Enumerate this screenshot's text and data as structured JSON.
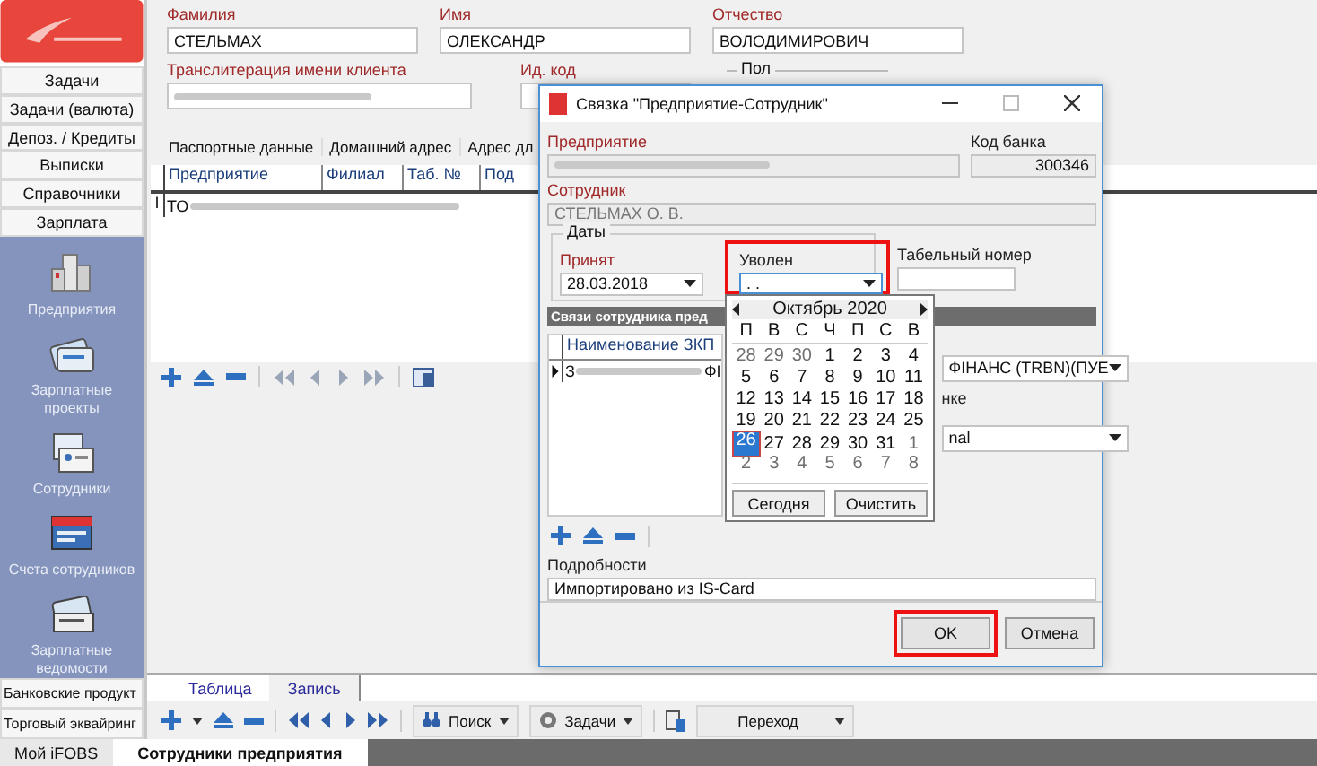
{
  "sidebar": {
    "nav_items": [
      "Задачи",
      "Задачи (валюта)",
      "Депоз. / Кредиты",
      "Выписки",
      "Справочники",
      "Зарплата"
    ],
    "panel_items": [
      {
        "label": "Предприятия",
        "kind": "building"
      },
      {
        "label": "Зарплатные проекты",
        "kind": "cards"
      },
      {
        "label": "Сотрудники",
        "kind": "badge"
      },
      {
        "label": "Счета сотрудников",
        "kind": "accounts"
      },
      {
        "label": "Зарплатные ведомости",
        "kind": "sheet"
      }
    ],
    "bottom_items": [
      "Банковские продукт",
      "Торговый эквайринг"
    ]
  },
  "client_form": {
    "fields": [
      {
        "label": "Фамилия",
        "value": "СТЕЛЬМАХ"
      },
      {
        "label": "Имя",
        "value": "ОЛЕКСАНДР"
      },
      {
        "label": "Отчество",
        "value": "ВОЛОДИМИРОВИЧ"
      }
    ],
    "translit_label": "Транслитерация имени клиента",
    "translit_redacted": true,
    "id_label": "Ид. код",
    "gender_legend": "Пол"
  },
  "detail_tabs": [
    {
      "label": "Паспортные данные",
      "selected": false
    },
    {
      "label": "Домашний адрес",
      "selected": false
    },
    {
      "label": "Адрес дл",
      "selected": false
    }
  ],
  "table": {
    "columns": [
      "Предприятие",
      "Филиал",
      "Таб. №",
      "Под"
    ],
    "row_marker": "I",
    "rows": [
      {
        "cells": [
          "ТО"
        ],
        "redacted": true
      }
    ]
  },
  "view_tabs": [
    {
      "label": "Таблица",
      "selected": true
    },
    {
      "label": "Запись",
      "selected": false
    }
  ],
  "bottom_toolbar": {
    "buttons": [
      "Поиск",
      "Задачи",
      "Переход"
    ]
  },
  "footer_tabs": [
    {
      "label": "Мой iFOBS",
      "selected": false
    },
    {
      "label": "Сотрудники предприятия",
      "selected": true
    }
  ],
  "dialog": {
    "title": "Связка \"Предприятие-Сотрудник\"",
    "enterprise_label": "Предприятие",
    "enterprise_redacted": true,
    "bank_code_label": "Код банка",
    "bank_code": "300346",
    "employee_label": "Сотрудник",
    "employee": "СТЕЛЬМАХ О. В.",
    "dates_legend": "Даты",
    "hired_label": "Принят",
    "hired": "28.03.2018",
    "fired_label": "Уволен",
    "fired": ". .",
    "fired_highlighted": true,
    "tab_number_label": "Табельный номер",
    "links_header": "Связи сотрудника пред",
    "links_column": "Наименование ЗКП",
    "links_row_start": "З",
    "links_row_end": "ФІ",
    "right_select": "ФІНАНС (TRBN)(ПУЕ",
    "right_label": "нке",
    "right_select2": "nal",
    "details_label": "Подробности",
    "details": "Импортировано из IS-Card",
    "ok": {
      "label": "OK",
      "highlighted": true
    },
    "cancel": "Отмена"
  },
  "calendar": {
    "month": "Октябрь 2020",
    "weekdays": [
      "П",
      "В",
      "С",
      "Ч",
      "П",
      "С",
      "В"
    ],
    "weeks": [
      [
        {
          "day": "28",
          "other": true,
          "selected": false
        },
        {
          "day": "29",
          "other": true,
          "selected": false
        },
        {
          "day": "30",
          "other": true,
          "selected": false
        },
        {
          "day": "1",
          "other": false,
          "selected": false
        },
        {
          "day": "2",
          "other": false,
          "selected": false
        },
        {
          "day": "3",
          "other": false,
          "selected": false
        },
        {
          "day": "4",
          "other": false,
          "selected": false
        }
      ],
      [
        {
          "day": "5",
          "other": false,
          "selected": false
        },
        {
          "day": "6",
          "other": false,
          "selected": false
        },
        {
          "day": "7",
          "other": false,
          "selected": false
        },
        {
          "day": "8",
          "other": false,
          "selected": false
        },
        {
          "day": "9",
          "other": false,
          "selected": false
        },
        {
          "day": "10",
          "other": false,
          "selected": false
        },
        {
          "day": "11",
          "other": false,
          "selected": false
        }
      ],
      [
        {
          "day": "12",
          "other": false,
          "selected": false
        },
        {
          "day": "13",
          "other": false,
          "selected": false
        },
        {
          "day": "14",
          "other": false,
          "selected": false
        },
        {
          "day": "15",
          "other": false,
          "selected": false
        },
        {
          "day": "16",
          "other": false,
          "selected": false
        },
        {
          "day": "17",
          "other": false,
          "selected": false
        },
        {
          "day": "18",
          "other": false,
          "selected": false
        }
      ],
      [
        {
          "day": "19",
          "other": false,
          "selected": false
        },
        {
          "day": "20",
          "other": false,
          "selected": false
        },
        {
          "day": "21",
          "other": false,
          "selected": false
        },
        {
          "day": "22",
          "other": false,
          "selected": false
        },
        {
          "day": "23",
          "other": false,
          "selected": false
        },
        {
          "day": "24",
          "other": false,
          "selected": false
        },
        {
          "day": "25",
          "other": false,
          "selected": false
        }
      ],
      [
        {
          "day": "26",
          "other": false,
          "selected": true
        },
        {
          "day": "27",
          "other": false,
          "selected": false
        },
        {
          "day": "28",
          "other": false,
          "selected": false
        },
        {
          "day": "29",
          "other": false,
          "selected": false
        },
        {
          "day": "30",
          "other": false,
          "selected": false
        },
        {
          "day": "31",
          "other": false,
          "selected": false
        },
        {
          "day": "1",
          "other": true,
          "selected": false
        }
      ],
      [
        {
          "day": "2",
          "other": true,
          "selected": false
        },
        {
          "day": "3",
          "other": true,
          "selected": false
        },
        {
          "day": "4",
          "other": true,
          "selected": false
        },
        {
          "day": "5",
          "other": true,
          "selected": false
        },
        {
          "day": "6",
          "other": true,
          "selected": false
        },
        {
          "day": "7",
          "other": true,
          "selected": false
        },
        {
          "day": "8",
          "other": true,
          "selected": false
        }
      ]
    ],
    "today": "Сегодня",
    "clear": "Очистить"
  }
}
